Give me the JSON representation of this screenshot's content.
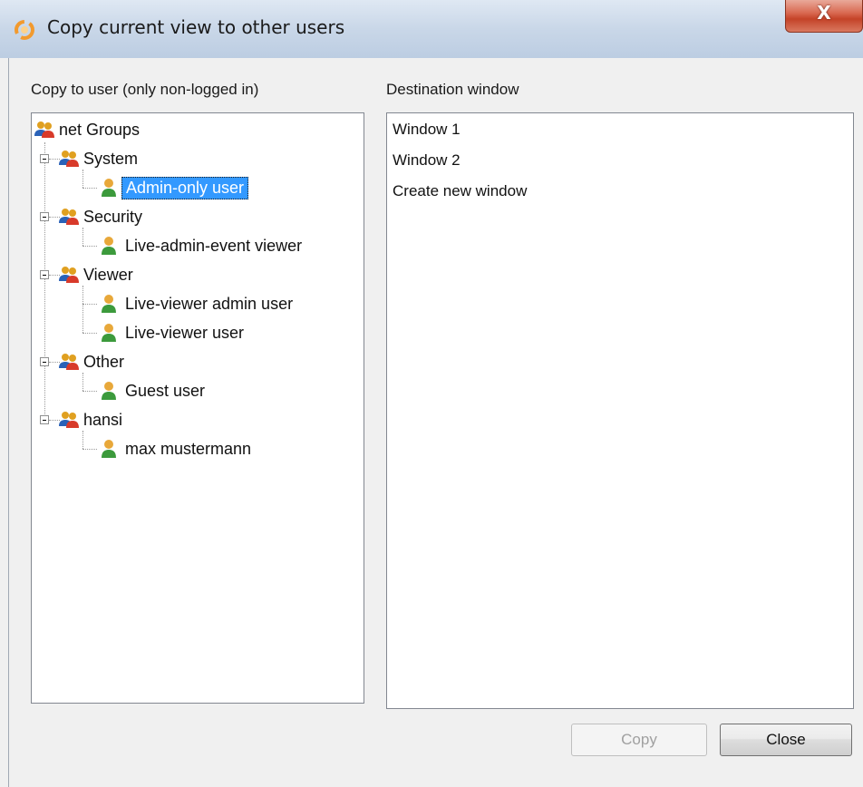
{
  "window": {
    "title": "Copy current view to other users",
    "close_glyph": "X",
    "app_icon": "refresh-orange-icon"
  },
  "left_panel": {
    "label": "Copy to user (only non-logged in)",
    "tree": {
      "root": "net Groups",
      "groups": [
        {
          "name": "System",
          "users": [
            "Admin-only user"
          ]
        },
        {
          "name": "Security",
          "users": [
            "Live-admin-event viewer"
          ]
        },
        {
          "name": "Viewer",
          "users": [
            "Live-viewer admin user",
            "Live-viewer user"
          ]
        },
        {
          "name": "Other",
          "users": [
            "Guest user"
          ]
        },
        {
          "name": "hansi",
          "users": [
            "max mustermann"
          ]
        }
      ],
      "selected_user": "Admin-only user"
    }
  },
  "right_panel": {
    "label": "Destination window",
    "items": [
      "Window 1",
      "Window 2",
      "Create new window"
    ]
  },
  "buttons": {
    "copy": "Copy",
    "close": "Close"
  },
  "colors": {
    "selection": "#3399ff",
    "group_icon": "#4a8a2a",
    "user_icon": "#3c9a3c"
  }
}
